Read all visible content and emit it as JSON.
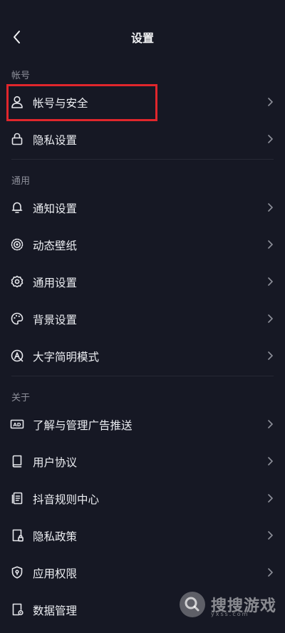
{
  "header": {
    "title": "设置"
  },
  "sections": [
    {
      "label": "帐号"
    },
    {
      "label": "通用"
    },
    {
      "label": "关于"
    }
  ],
  "items": {
    "account_security": {
      "label": "帐号与安全",
      "icon": "user-icon"
    },
    "privacy_settings": {
      "label": "隐私设置",
      "icon": "lock-icon"
    },
    "notification_settings": {
      "label": "通知设置",
      "icon": "bell-icon"
    },
    "live_wallpaper": {
      "label": "动态壁纸",
      "icon": "wallpaper-icon"
    },
    "general_settings": {
      "label": "通用设置",
      "icon": "gear-icon"
    },
    "background_settings": {
      "label": "背景设置",
      "icon": "palette-icon"
    },
    "large_text_mode": {
      "label": "大字简明模式",
      "icon": "font-size-icon"
    },
    "ad_management": {
      "label": "了解与管理广告推送",
      "icon": "ad-icon"
    },
    "user_agreement": {
      "label": "用户协议",
      "icon": "book-icon"
    },
    "community_rules": {
      "label": "抖音规则中心",
      "icon": "document-icon"
    },
    "privacy_policy": {
      "label": "隐私政策",
      "icon": "privacy-doc-icon"
    },
    "app_permissions": {
      "label": "应用权限",
      "icon": "shield-icon"
    },
    "data_management": {
      "label": "数据管理",
      "icon": "data-doc-icon"
    }
  },
  "icons": {
    "ad_badge_text": "AD"
  },
  "watermark": {
    "text": "搜搜游戏",
    "domain": "yxss.com"
  },
  "colors": {
    "background": "#161824",
    "highlight": "#e0262c",
    "text": "#eceef2",
    "muted": "#8d8f9a"
  }
}
